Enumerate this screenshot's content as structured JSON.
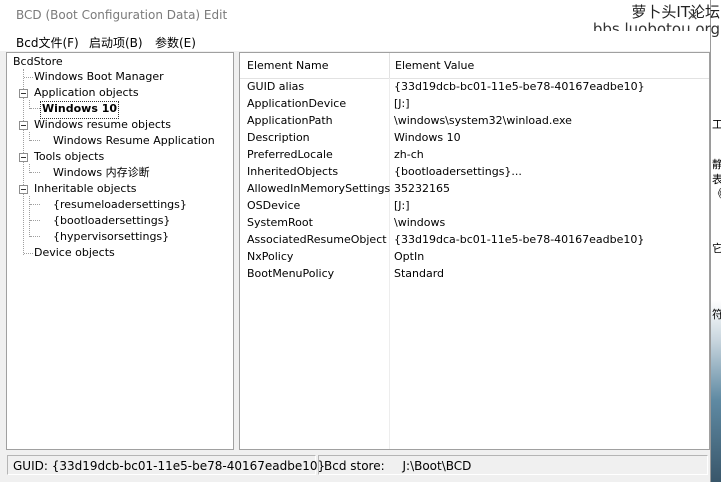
{
  "window": {
    "title": "BCD (Boot Configuration Data) Edit",
    "close_glyph": "×",
    "watermark_line1": "萝卜头IT论坛",
    "watermark_line2": "bbs.luobotou.org"
  },
  "menu": [
    "Bcd文件(F)",
    "启动项(B)",
    "参数(E)"
  ],
  "tree": {
    "root": "BcdStore",
    "nodes": [
      {
        "label": "Windows Boot Manager"
      },
      {
        "label": "Application objects"
      },
      {
        "label": "Windows 10",
        "selected": true
      },
      {
        "label": "Windows resume objects"
      },
      {
        "label": "Windows Resume Application"
      },
      {
        "label": "Tools objects"
      },
      {
        "label": "Windows 内存诊断"
      },
      {
        "label": "Inheritable objects"
      },
      {
        "label": "{resumeloadersettings}"
      },
      {
        "label": "{bootloadersettings}"
      },
      {
        "label": "{hypervisorsettings}"
      },
      {
        "label": "Device objects"
      }
    ]
  },
  "grid": {
    "columns": [
      "Element Name",
      "Element Value"
    ],
    "rows": [
      {
        "name": "GUID alias",
        "value": "{33d19dcb-bc01-11e5-be78-40167eadbe10}"
      },
      {
        "name": "ApplicationDevice",
        "value": "[J:]"
      },
      {
        "name": "ApplicationPath",
        "value": "\\windows\\system32\\winload.exe"
      },
      {
        "name": "Description",
        "value": "Windows 10"
      },
      {
        "name": "PreferredLocale",
        "value": "zh-ch"
      },
      {
        "name": "InheritedObjects",
        "value": "{bootloadersettings}..."
      },
      {
        "name": "AllowedInMemorySettings",
        "value": "35232165"
      },
      {
        "name": "OSDevice",
        "value": "[J:]"
      },
      {
        "name": "SystemRoot",
        "value": "\\windows"
      },
      {
        "name": "AssociatedResumeObject",
        "value": "{33d19dca-bc01-11e5-be78-40167eadbe10}"
      },
      {
        "name": "NxPolicy",
        "value": "OptIn"
      },
      {
        "name": "BootMenuPolicy",
        "value": "Standard"
      }
    ]
  },
  "status": {
    "guid_label": "GUID:",
    "guid_value": "{33d19dcb-bc01-11e5-be78-40167eadbe10}",
    "store_label": "Bcd store:",
    "store_value": "J:\\Boot\\BCD"
  },
  "background_glyphs": [
    "工",
    "静",
    "表",
    "《",
    "它",
    "符"
  ]
}
